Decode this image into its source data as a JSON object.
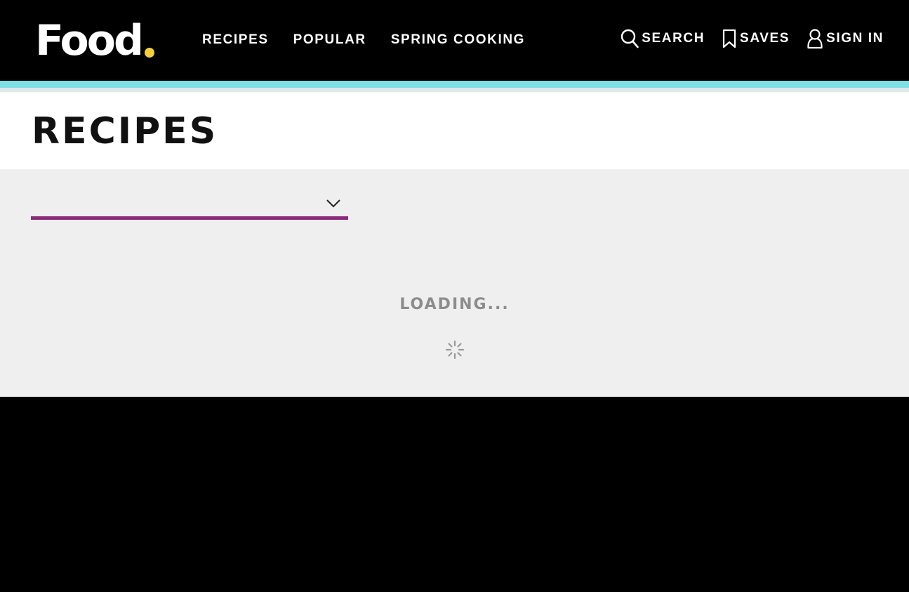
{
  "colors": {
    "header_bg": "#000000",
    "accent_cyan": "#7fdfe2",
    "logo_dot": "#f7cf3c",
    "underline_purple": "#8c2a7e",
    "loading_text": "#8c8c8c",
    "content_bg": "#efefef"
  },
  "header": {
    "logo": "Food",
    "nav": [
      {
        "label": "RECIPES"
      },
      {
        "label": "POPULAR"
      },
      {
        "label": "SPRING COOKING"
      }
    ],
    "utils": {
      "search": {
        "label": "SEARCH",
        "icon": "search-icon"
      },
      "saves": {
        "label": "SAVES",
        "icon": "bookmark-icon"
      },
      "signin": {
        "label": "SIGN IN",
        "icon": "user-icon"
      }
    }
  },
  "page": {
    "title": "RECIPES"
  },
  "filter": {
    "value": "",
    "icon": "chevron-down-icon"
  },
  "status": {
    "loading_text": "LOADING...",
    "icon": "spinner-icon"
  }
}
